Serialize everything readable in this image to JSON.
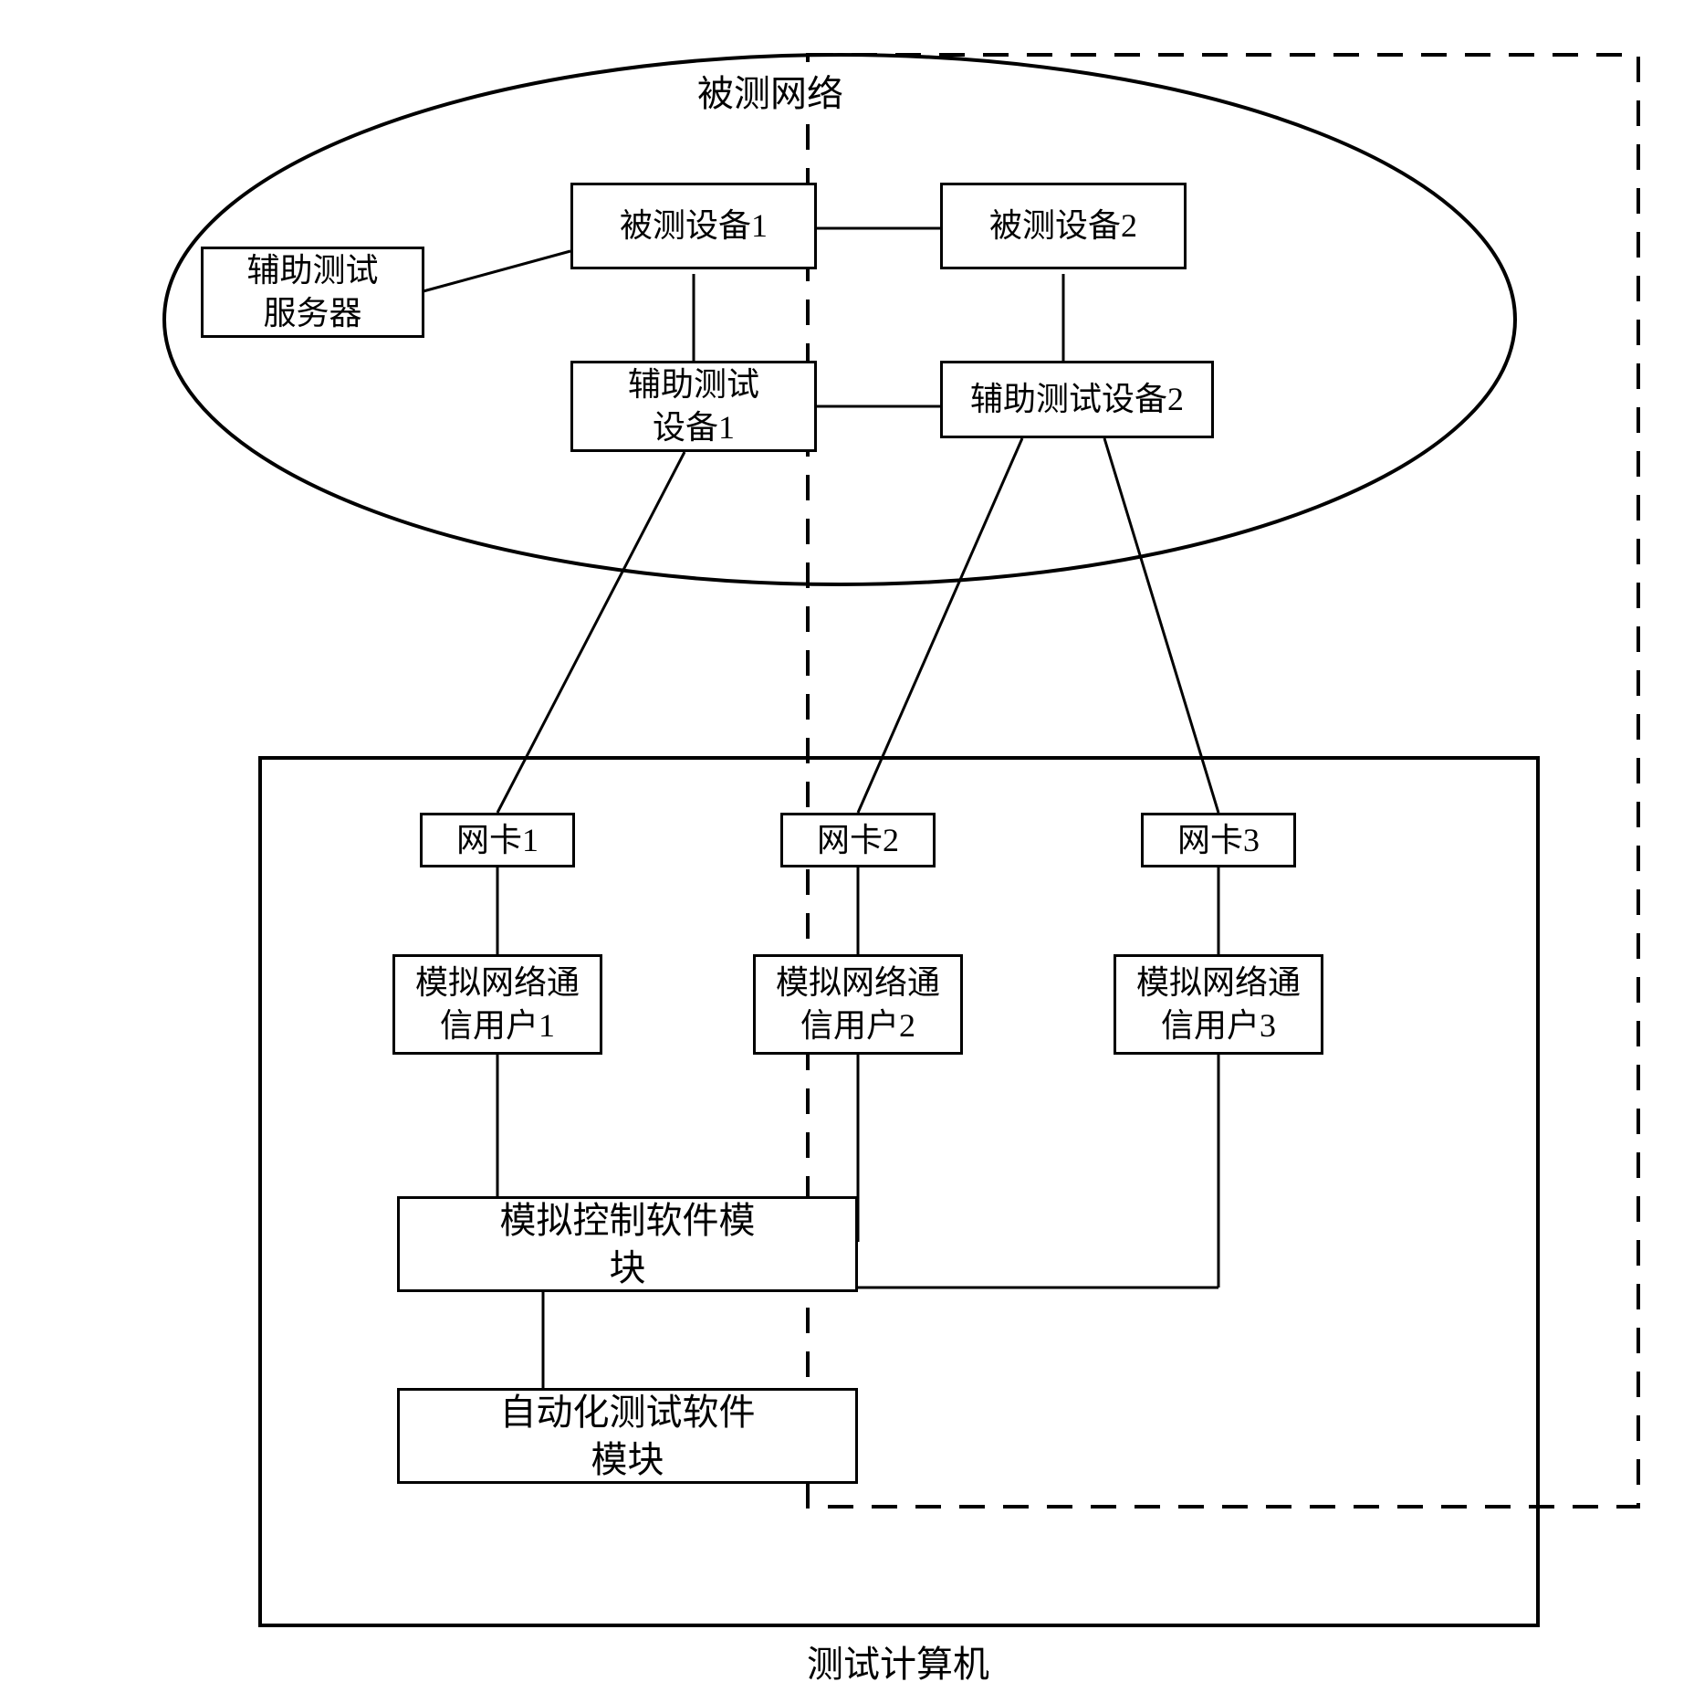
{
  "diagram": {
    "tested_network_label": "被测网络",
    "aux_test_server": "辅助测试\n服务器",
    "dut1": "被测设备1",
    "dut2": "被测设备2",
    "aux_dev1": "辅助测试\n设备1",
    "aux_dev2": "辅助测试设备2",
    "nic1": "网卡1",
    "nic2": "网卡2",
    "nic3": "网卡3",
    "sim_user1": "模拟网络通\n信用户1",
    "sim_user2": "模拟网络通\n信用户2",
    "sim_user3": "模拟网络通\n信用户3",
    "sim_ctrl": "模拟控制软件模\n块",
    "auto_test": "自动化测试软件\n模块",
    "test_computer_label": "测试计算机"
  }
}
